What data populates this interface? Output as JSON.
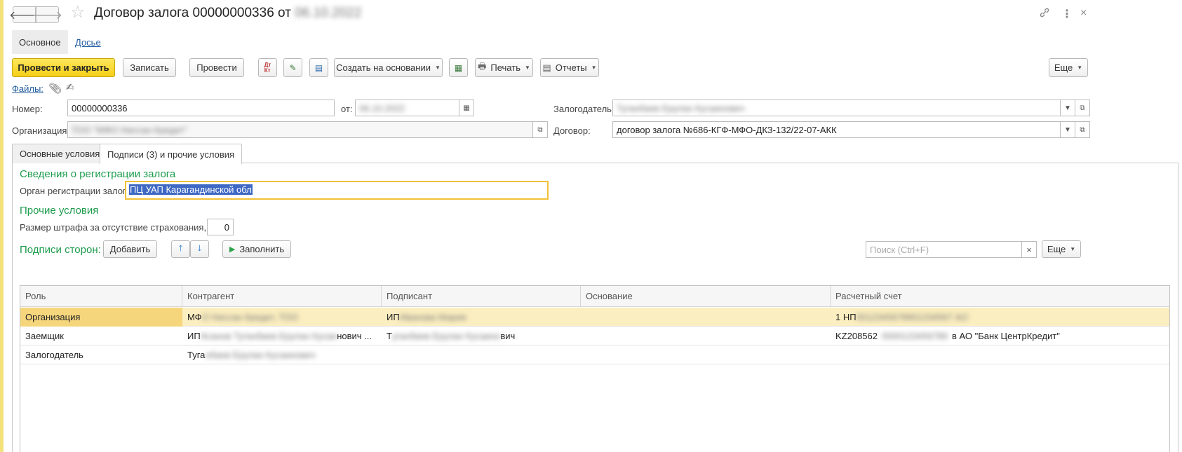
{
  "window": {
    "title": "Договор залога 00000000336 от",
    "title_date_blurred": "06.10.2022"
  },
  "section_tabs": [
    "Основное",
    "Досье"
  ],
  "toolbar": {
    "post_close": "Провести и закрыть",
    "save": "Записать",
    "post": "Провести",
    "create_based": "Создать на основании",
    "print": "Печать",
    "reports": "Отчеты",
    "more": "Еще"
  },
  "files_link": "Файлы:",
  "form": {
    "number_label": "Номер:",
    "number_value": "00000000336",
    "date_label": "от:",
    "date_value_blurred": "06.10.2022",
    "organization_label": "Организация:",
    "organization_value_blurred": "ТОО \"МФО Ниссан Кредит\"",
    "pledger_label": "Залогодатель:",
    "pledger_value_blurred": "Туганбаев Ерулан Кусаинович",
    "contract_label": "Договор:",
    "contract_value": "договор залога №686-КГФ-МФО-ДКЗ-132/22-07-АКК"
  },
  "tabs": [
    "Основные условия",
    "Подписи (3) и прочие условия"
  ],
  "registration": {
    "header": "Сведения о регистрации залога",
    "label": "Орган регистрации залога:",
    "value": "ПЦ УАП Карагандинской обл"
  },
  "other_conditions": {
    "header": "Прочие условия",
    "fine_label": "Размер штрафа за отсутствие страхования, %:",
    "fine_value": "0"
  },
  "signatures": {
    "header": "Подписи сторон:",
    "add_button": "Добавить",
    "fill_button": "Заполнить",
    "search_placeholder": "Поиск (Ctrl+F)",
    "more_button": "Еще",
    "columns": [
      "Роль",
      "Контрагент",
      "Подписант",
      "Основание",
      "Расчетный счет"
    ],
    "rows": [
      {
        "role": "Организация",
        "counterparty": "МФ",
        "counterparty_blur": "О Ниссан Кредит, ТОО",
        "signer": "ИП",
        "signer_blur": "Иванова Мария",
        "basis": "",
        "account": "1 НП",
        "account_blur": "0012345678901234567 АО"
      },
      {
        "role": "Заемщик",
        "counterparty": "ИП",
        "counterparty_blur": "Асанов Туганбаев Ерулан Кусаи",
        "counterparty_tail": "нович ...",
        "signer": "Т",
        "signer_blur": "уганбаев Ерулан Кусаино",
        "signer_tail": "вич",
        "basis": "",
        "account": "KZ208562",
        "account_blur": "0000123456789",
        "account_tail": "в АО \"Банк ЦентрКредит\""
      },
      {
        "role": "Залогодатель",
        "counterparty": "Туга",
        "counterparty_blur": "нбаев Ерулан Кусаинович",
        "signer": "",
        "basis": "",
        "account": ""
      }
    ]
  },
  "colors": {
    "primary_button": "#f6cf18",
    "section_header": "#1d9c4d",
    "link": "#215ba0",
    "selected_row": "#fbeec0",
    "focus_border": "#f2c037"
  }
}
